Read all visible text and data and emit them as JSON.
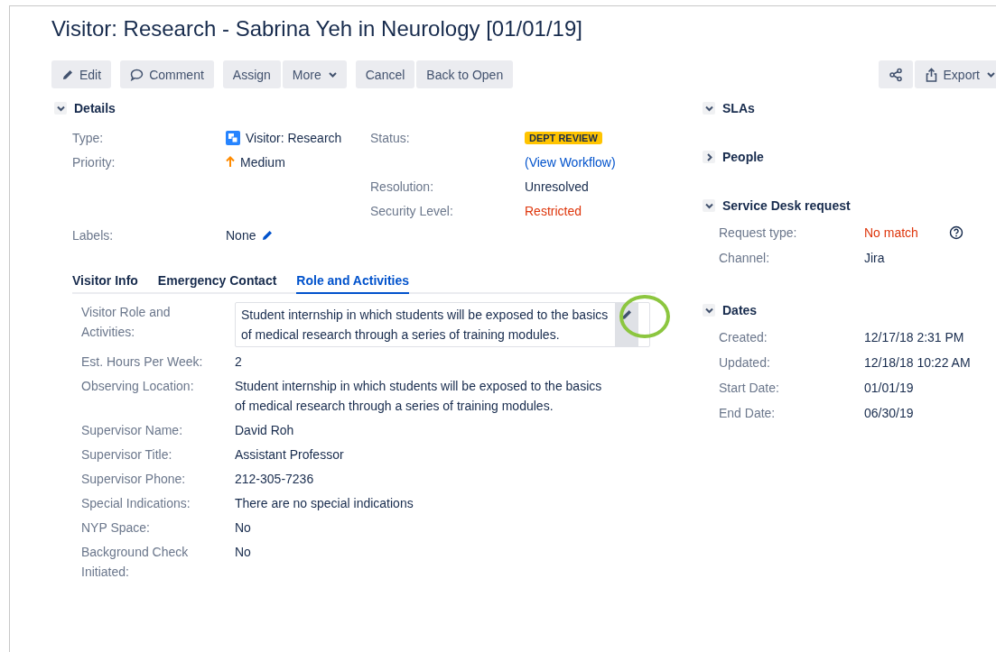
{
  "title": "Visitor: Research - Sabrina Yeh in Neurology [01/01/19]",
  "toolbar": {
    "left_groups": [
      [
        {
          "label": "Edit",
          "kind": "edit"
        }
      ],
      [
        {
          "label": "Comment",
          "kind": "comment"
        }
      ],
      [
        {
          "label": "Assign"
        },
        {
          "label": "More",
          "dropdown": true
        }
      ],
      [
        {
          "label": "Cancel"
        },
        {
          "label": "Back to Open"
        }
      ]
    ],
    "right_groups": [
      [
        {
          "kind": "share"
        },
        {
          "label": "Export",
          "kind": "export",
          "dropdown": true
        }
      ]
    ]
  },
  "details": {
    "title": "Details",
    "expanded": true,
    "rows": [
      [
        {
          "label": "Type:",
          "value": "Visitor: Research",
          "kind": "issuetype"
        },
        {
          "label": "Status:",
          "value": "DEPT REVIEW",
          "kind": "lozenge"
        }
      ],
      [
        {
          "label": "Priority:",
          "value": "Medium",
          "kind": "priority"
        },
        {
          "value": "(View Workflow)",
          "kind": "link"
        }
      ],
      [
        {},
        {
          "label": "Resolution:",
          "value": "Unresolved",
          "kind": "text"
        }
      ],
      [
        {},
        {
          "label": "Security Level:",
          "value": "Restricted",
          "kind": "danger"
        }
      ],
      [
        {
          "label": "Labels:",
          "value": "None",
          "kind": "editable"
        },
        {}
      ]
    ]
  },
  "tabs": [
    {
      "label": "Visitor Info",
      "selected": false
    },
    {
      "label": "Emergency Contact",
      "selected": false
    },
    {
      "label": "Role and Activities",
      "selected": true
    }
  ],
  "tab_fields": [
    {
      "label": "Visitor Role and Activities:",
      "value": "Student internship in which students will be exposed to the basics of medical research through a series of training modules.",
      "kind": "editing",
      "highlighted": true
    },
    {
      "label": "Est. Hours Per Week:",
      "value": "2",
      "kind": "text"
    },
    {
      "label": "Observing Location:",
      "value": "Student internship in which students will be exposed to the basics of medical research through a series of training modules.",
      "kind": "text"
    },
    {
      "label": "Supervisor Name:",
      "value": "David Roh",
      "kind": "text"
    },
    {
      "label": "Supervisor Title:",
      "value": "Assistant Professor",
      "kind": "text"
    },
    {
      "label": "Supervisor Phone:",
      "value": "212-305-7236",
      "kind": "text"
    },
    {
      "label": "Special Indications:",
      "value": "There are no special indications",
      "kind": "text"
    },
    {
      "label": "NYP Space:",
      "value": "No",
      "kind": "text"
    },
    {
      "label": "Background Check Initiated:",
      "value": "No",
      "kind": "text"
    }
  ],
  "sidebar": [
    {
      "title": "SLAs",
      "expanded": true
    },
    {
      "title": "People",
      "expanded": false
    },
    {
      "title": "Service Desk request",
      "expanded": true,
      "fields": [
        {
          "label": "Request type:",
          "value": "No match",
          "kind": "danger",
          "help": true
        },
        {
          "label": "Channel:",
          "value": "Jira",
          "kind": "text"
        }
      ]
    },
    {
      "title": "Dates",
      "expanded": true,
      "fields": [
        {
          "label": "Created:",
          "value": "12/17/18 2:31 PM",
          "kind": "text"
        },
        {
          "label": "Updated:",
          "value": "12/18/18 10:22 AM",
          "kind": "text"
        },
        {
          "label": "Start Date:",
          "value": "01/01/19",
          "kind": "text"
        },
        {
          "label": "End Date:",
          "value": "06/30/19",
          "kind": "text"
        }
      ]
    }
  ]
}
